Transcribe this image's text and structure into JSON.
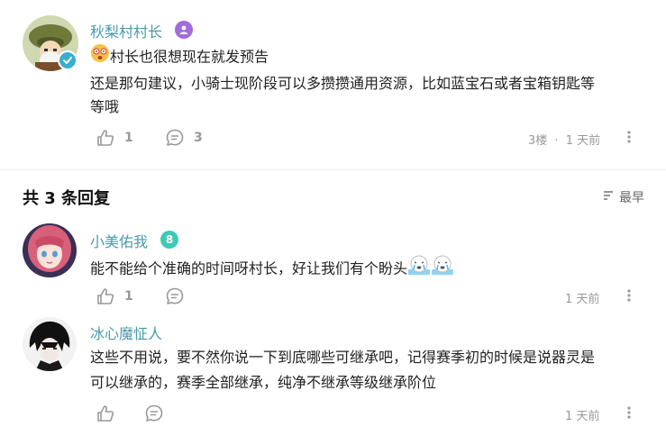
{
  "main_comment": {
    "author": "秋梨村村长",
    "text_line1": "村长也很想现在就发预告",
    "text_line2": "还是那句建议，小骑士现阶段可以多攒攒通用资源，比如蓝宝石或者宝箱钥匙等",
    "text_line3": "等哦",
    "like_count": "1",
    "reply_count": "3",
    "floor": "3楼",
    "separator": "·",
    "time": "1 天前"
  },
  "replies_header": {
    "title": "共 3 条回复",
    "sort_label": "最早"
  },
  "replies": [
    {
      "author": "小美佑我",
      "level": "8",
      "text_line1": "能不能给个准确的时间呀村长，好让我们有个盼头",
      "like_count": "1",
      "time": "1 天前"
    },
    {
      "author": "冰心魔怔人",
      "text_line1": "这些不用说，要不然你说一下到底哪些可继承吧，记得赛季初的时候是说器灵是",
      "text_line2": "可以继承的，赛季全部继承，纯净不继承等级继承阶位",
      "time": "1 天前"
    }
  ],
  "colors": {
    "name": "#4a9aa8",
    "verified_badge": "#a26bdb",
    "level_badge": "#3ec9b7",
    "meta": "#999999"
  }
}
